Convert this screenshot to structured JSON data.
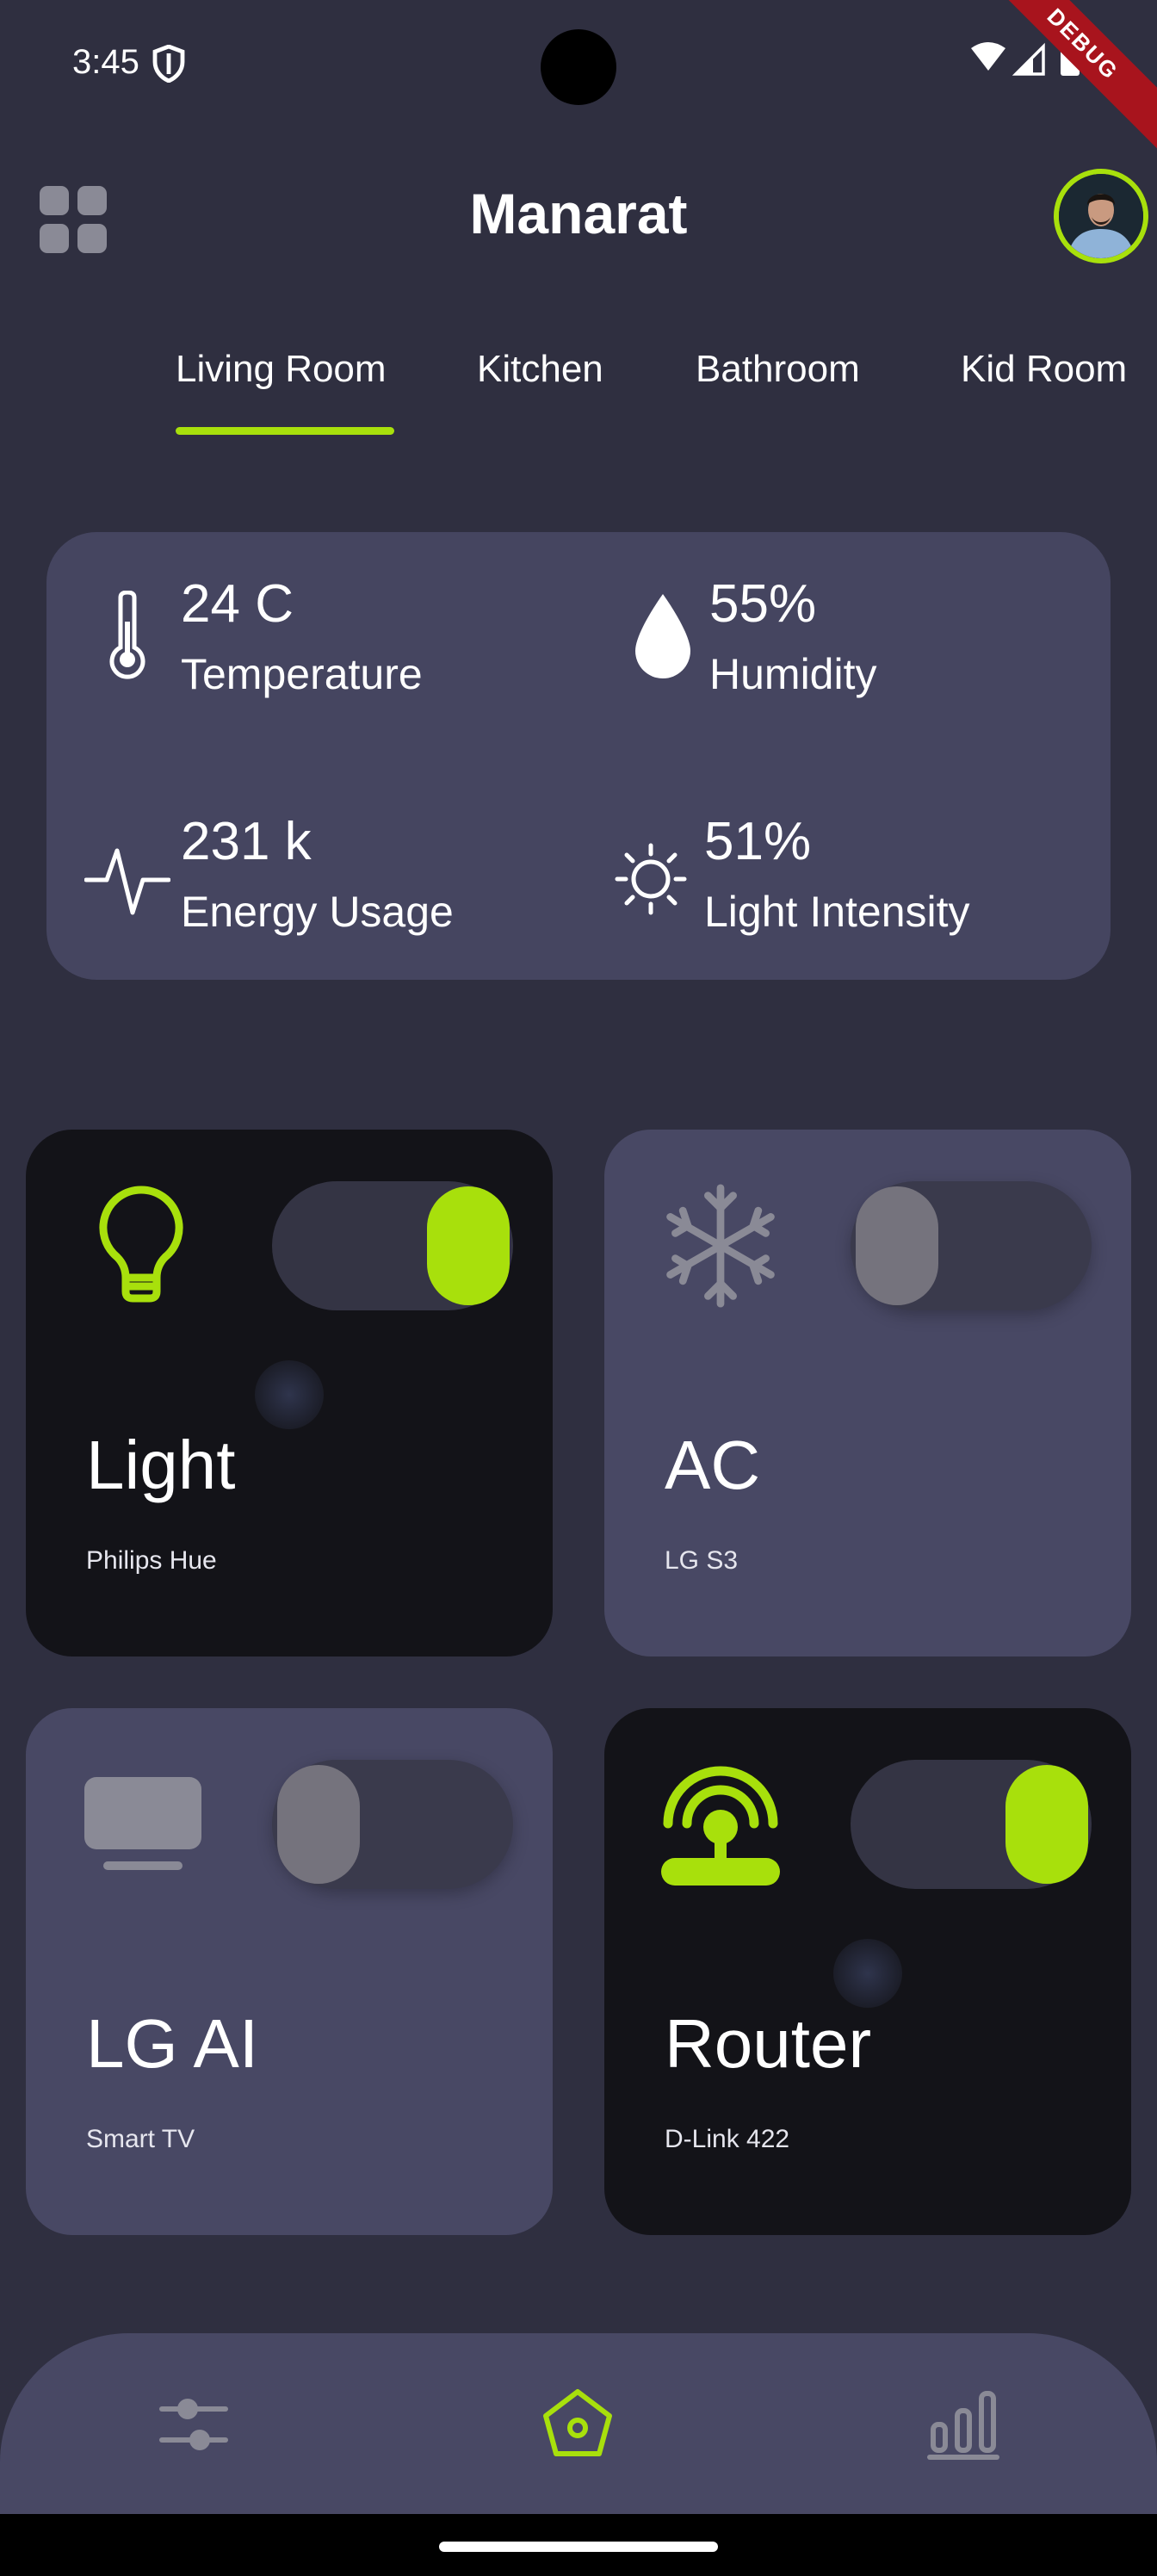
{
  "status_bar": {
    "time": "3:45",
    "debug_label": "DEBUG",
    "icons": [
      "shield-icon",
      "wifi-icon",
      "signal-icon",
      "battery-icon"
    ]
  },
  "header": {
    "title": "Manarat",
    "menu_icon": "grid-menu-icon",
    "avatar": "user-avatar"
  },
  "tabs": [
    {
      "label": "Living Room",
      "active": true
    },
    {
      "label": "Kitchen",
      "active": false
    },
    {
      "label": "Bathroom",
      "active": false
    },
    {
      "label": "Kid Room",
      "active": false
    }
  ],
  "sensors": [
    {
      "icon": "thermometer-icon",
      "value": "24 C",
      "label": "Temperature"
    },
    {
      "icon": "water-drop-icon",
      "value": "55%",
      "label": "Humidity"
    },
    {
      "icon": "activity-pulse-icon",
      "value": "231 k",
      "label": "Energy Usage"
    },
    {
      "icon": "sun-icon",
      "value": "51%",
      "label": "Light Intensity"
    }
  ],
  "devices": [
    {
      "name": "Light",
      "model": "Philips Hue",
      "icon": "lightbulb-icon",
      "on": true
    },
    {
      "name": "AC",
      "model": "LG S3",
      "icon": "snowflake-icon",
      "on": false
    },
    {
      "name": "LG AI",
      "model": "Smart TV",
      "icon": "tv-icon",
      "on": false
    },
    {
      "name": "Router",
      "model": "D-Link 422",
      "icon": "router-icon",
      "on": true
    }
  ],
  "bottom_nav": [
    {
      "icon": "sliders-icon",
      "active": false
    },
    {
      "icon": "home-icon",
      "active": true
    },
    {
      "icon": "bar-chart-icon",
      "active": false
    }
  ],
  "colors": {
    "background": "#2f2f40",
    "accent": "#a8e00c",
    "card_light": "#484864",
    "card_dark": "#131318",
    "sensor_card": "#454560"
  }
}
